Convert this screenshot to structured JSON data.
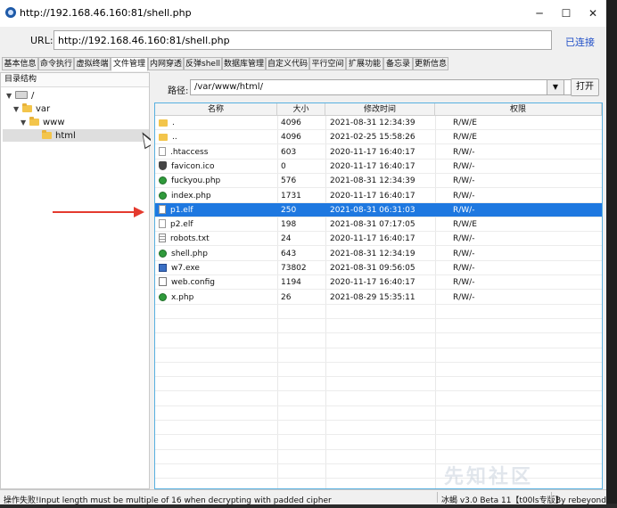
{
  "window": {
    "title": "http://192.168.46.160:81/shell.php",
    "min_icon": "─",
    "max_icon": "☐",
    "close_icon": "✕"
  },
  "urlbar": {
    "label": "URL:",
    "value": "http://192.168.46.160:81/shell.php",
    "status": "已连接"
  },
  "tabs": [
    {
      "label": "基本信息"
    },
    {
      "label": "命令执行"
    },
    {
      "label": "虚拟终端"
    },
    {
      "label": "文件管理"
    },
    {
      "label": "内网穿透"
    },
    {
      "label": "反弹shell"
    },
    {
      "label": "数据库管理"
    },
    {
      "label": "自定义代码"
    },
    {
      "label": "平行空间"
    },
    {
      "label": "扩展功能"
    },
    {
      "label": "备忘录"
    },
    {
      "label": "更新信息"
    }
  ],
  "tree": {
    "header": "目录结构",
    "nodes": [
      {
        "label": "/",
        "arrow": "▼",
        "icon": "drive-icon"
      },
      {
        "label": "var",
        "arrow": "▼",
        "icon": "folder-icon"
      },
      {
        "label": "www",
        "arrow": "▼",
        "icon": "folder-icon"
      },
      {
        "label": "html",
        "arrow": "",
        "icon": "folder-icon"
      }
    ]
  },
  "pathbar": {
    "label": "路径:",
    "value": "/var/www/html/",
    "dropdown_icon": "▼",
    "open_label": "打开"
  },
  "table": {
    "columns": [
      "名称",
      "大小",
      "修改时间",
      "权限"
    ],
    "rows": [
      {
        "icon": "folder-icon",
        "name": ".",
        "size": "4096",
        "mtime": "2021-08-31 12:34:39",
        "perm": "R/W/E"
      },
      {
        "icon": "folder-icon",
        "name": "..",
        "size": "4096",
        "mtime": "2021-02-25 15:58:26",
        "perm": "R/W/E"
      },
      {
        "icon": "file-icon",
        "name": ".htaccess",
        "size": "603",
        "mtime": "2020-11-17 16:40:17",
        "perm": "R/W/-"
      },
      {
        "icon": "shield-icon",
        "name": "favicon.ico",
        "size": "0",
        "mtime": "2020-11-17 16:40:17",
        "perm": "R/W/-"
      },
      {
        "icon": "php-icon",
        "name": "fuckyou.php",
        "size": "576",
        "mtime": "2021-08-31 12:34:39",
        "perm": "R/W/-"
      },
      {
        "icon": "php-icon",
        "name": "index.php",
        "size": "1731",
        "mtime": "2020-11-17 16:40:17",
        "perm": "R/W/-"
      },
      {
        "icon": "file-icon",
        "name": "p1.elf",
        "size": "250",
        "mtime": "2021-08-31 06:31:03",
        "perm": "R/W/-",
        "selected": true
      },
      {
        "icon": "file-icon",
        "name": "p2.elf",
        "size": "198",
        "mtime": "2021-08-31 07:17:05",
        "perm": "R/W/E"
      },
      {
        "icon": "text-icon",
        "name": "robots.txt",
        "size": "24",
        "mtime": "2020-11-17 16:40:17",
        "perm": "R/W/-"
      },
      {
        "icon": "php-icon",
        "name": "shell.php",
        "size": "643",
        "mtime": "2021-08-31 12:34:19",
        "perm": "R/W/-"
      },
      {
        "icon": "exe-icon",
        "name": "w7.exe",
        "size": "73802",
        "mtime": "2021-08-31 09:56:05",
        "perm": "R/W/-"
      },
      {
        "icon": "config-icon",
        "name": "web.config",
        "size": "1194",
        "mtime": "2020-11-17 16:40:17",
        "perm": "R/W/-"
      },
      {
        "icon": "php-icon",
        "name": "x.php",
        "size": "26",
        "mtime": "2021-08-29 15:35:11",
        "perm": "R/W/-"
      }
    ]
  },
  "statusbar": {
    "message": "操作失败!Input length must be multiple of 16 when decrypting with padded cipher",
    "version": "冰蝎 v3.0 Beta 11【t00ls专版】",
    "author": "By rebeyond"
  },
  "watermark": "先知社区",
  "colors": {
    "selection": "#1e78e0",
    "link": "#1f4ec7",
    "annotation_arrow": "#e43a2e",
    "table_border": "#57b0e0"
  }
}
